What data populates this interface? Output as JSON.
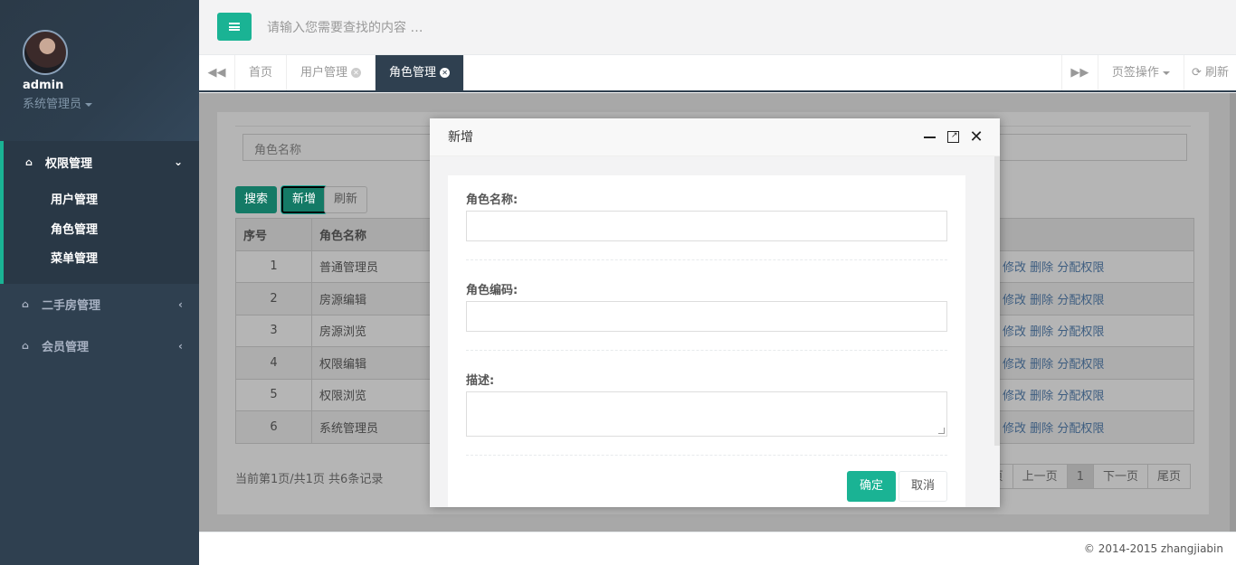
{
  "sidebar": {
    "user": {
      "name": "admin",
      "role": "系统管理员"
    },
    "groups": [
      {
        "label": "权限管理",
        "icon": "home-icon",
        "expanded": true,
        "items": [
          "用户管理",
          "角色管理",
          "菜单管理"
        ]
      },
      {
        "label": "二手房管理",
        "icon": "home-icon",
        "expanded": false
      },
      {
        "label": "会员管理",
        "icon": "home-icon",
        "expanded": false
      }
    ]
  },
  "topbar": {
    "search_placeholder": "请输入您需要查找的内容 …"
  },
  "tabs": {
    "items": [
      "首页",
      "用户管理",
      "角色管理"
    ],
    "active": "角色管理",
    "page_ops": "页签操作",
    "refresh": "刷新"
  },
  "main": {
    "role_name_placeholder": "角色名称",
    "buttons": {
      "search": "搜索",
      "add": "新增",
      "refresh": "刷新"
    },
    "table": {
      "headers": [
        "序号",
        "角色名称"
      ],
      "rows": [
        {
          "no": "1",
          "name": "普通管理员"
        },
        {
          "no": "2",
          "name": "房源编辑"
        },
        {
          "no": "3",
          "name": "房源浏览"
        },
        {
          "no": "4",
          "name": "权限编辑"
        },
        {
          "no": "5",
          "name": "权限浏览"
        },
        {
          "no": "6",
          "name": "系统管理员"
        }
      ],
      "ops": {
        "edit": "修改",
        "delete": "删除",
        "assign": "分配权限"
      }
    },
    "page_info": "当前第1页/共1页  共6条记录",
    "pager": [
      "页",
      "上一页",
      "1",
      "下一页",
      "尾页"
    ]
  },
  "footer": "© 2014-2015 zhangjiabin",
  "modal": {
    "title": "新增",
    "fields": {
      "role_name": "角色名称:",
      "role_code": "角色编码:",
      "desc": "描述:"
    },
    "ok": "确定",
    "cancel": "取消"
  },
  "colors": {
    "accent": "#1ab394",
    "sidebar": "#2f4050"
  }
}
